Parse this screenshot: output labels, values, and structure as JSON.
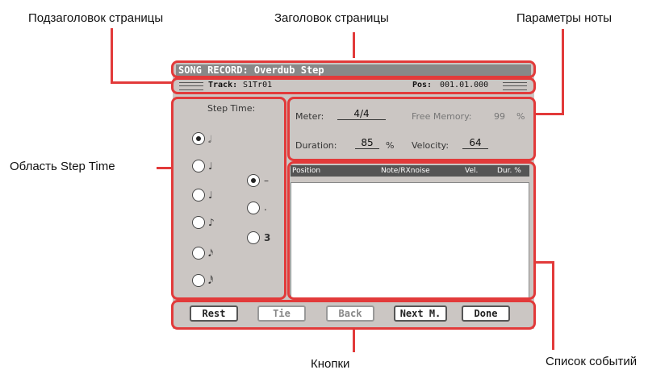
{
  "callouts": {
    "subtitle": "Подзаголовок страницы",
    "title": "Заголовок страницы",
    "note_params": "Параметры ноты",
    "step_time_area": "Область Step Time",
    "buttons": "Кнопки",
    "event_list": "Список событий"
  },
  "screen": {
    "title": "SONG RECORD: Overdub Step",
    "track_label": "Track:",
    "track_value": "S1Tr01",
    "pos_label": "Pos:",
    "pos_value": "001.01.000"
  },
  "step_time": {
    "label": "Step Time:",
    "values": [
      "𝅗𝅥",
      "♩",
      "♩",
      "♪",
      "𝅘𝅥𝅯",
      "𝅘𝅥𝅰"
    ],
    "selected_index": 0,
    "modifiers": [
      "–",
      ".",
      "3"
    ],
    "selected_modifier_index": 0
  },
  "params": {
    "meter_label": "Meter:",
    "meter_value": "4/4",
    "free_memory_label": "Free Memory:",
    "free_memory_value": "99",
    "free_memory_unit": "%",
    "duration_label": "Duration:",
    "duration_value": "85",
    "duration_unit": "%",
    "velocity_label": "Velocity:",
    "velocity_value": "64"
  },
  "event_list": {
    "columns": [
      "Position",
      "Note/RXnoise",
      "Vel.",
      "Dur. %"
    ]
  },
  "buttons": [
    {
      "label": "Rest",
      "enabled": true
    },
    {
      "label": "Tie",
      "enabled": false
    },
    {
      "label": "Back",
      "enabled": false
    },
    {
      "label": "Next M.",
      "enabled": true
    },
    {
      "label": "Done",
      "enabled": true
    }
  ]
}
